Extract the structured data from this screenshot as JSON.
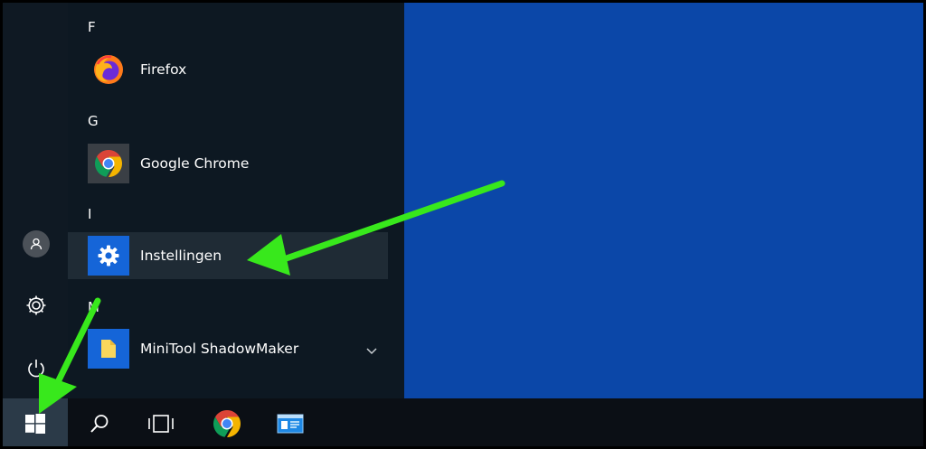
{
  "start_menu": {
    "sections": [
      {
        "letter": "F",
        "apps": [
          {
            "label": "Firefox",
            "icon": "firefox-icon"
          }
        ]
      },
      {
        "letter": "G",
        "apps": [
          {
            "label": "Google Chrome",
            "icon": "chrome-icon"
          }
        ]
      },
      {
        "letter": "I",
        "apps": [
          {
            "label": "Instellingen",
            "icon": "gear-icon",
            "highlighted": true
          }
        ]
      },
      {
        "letter": "M",
        "apps": [
          {
            "label": "MiniTool ShadowMaker",
            "icon": "folder-icon",
            "expandable": true
          }
        ]
      }
    ]
  },
  "rail": [
    "user-avatar-icon",
    "settings-gear-icon",
    "power-icon"
  ],
  "taskbar": [
    "windows-start-icon",
    "search-icon",
    "task-view-icon",
    "chrome-icon",
    "app-window-icon"
  ],
  "colors": {
    "desktop": "#0b47a8",
    "menu_bg": "#0d1822",
    "highlight_row": "#1f2b35",
    "accent_tile": "#1565d8",
    "arrow": "#38e81c",
    "taskbar": "#0b0f15"
  }
}
